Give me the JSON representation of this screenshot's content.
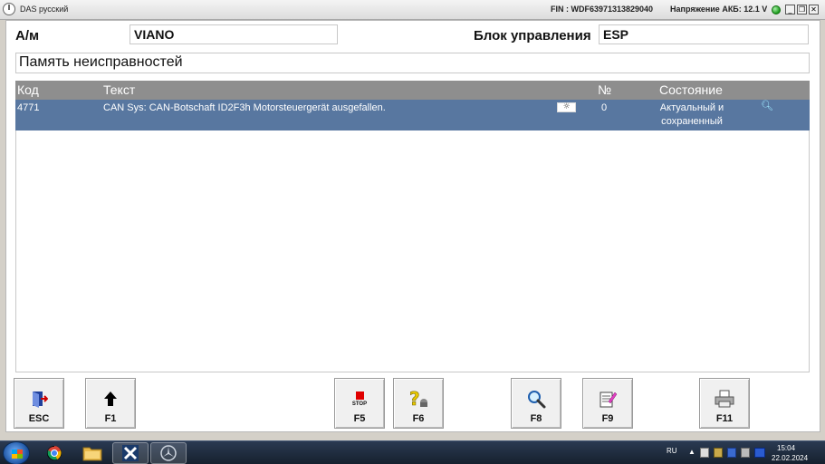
{
  "window": {
    "title": "DAS русский",
    "fin": "FIN : WDF63971313829040",
    "battery_voltage": "Напряжение АКБ: 12.1 V",
    "battery_status_color": "#1a9a1a",
    "minimize_glyph": "_",
    "restore_glyph": "❐",
    "close_glyph": "✕"
  },
  "header": {
    "vehicle_label": "А/м",
    "vehicle_value": "VIANO",
    "control_unit_label": "Блок управления",
    "control_unit_value": "ESP",
    "section_title": "Память неисправностей"
  },
  "fault_table": {
    "columns": {
      "code": "Код",
      "text": "Текст",
      "number": "№",
      "status": "Состояние"
    },
    "rows": [
      {
        "code": "4771",
        "text": "CAN Sys: CAN-Botschaft ID2F3h Motorsteuergerät ausgefallen.",
        "environment_icon": "sun-icon",
        "number": "0",
        "status_line1": "Актуальный и",
        "status_line2": "сохраненный",
        "detail_icon": "magnifier-icon",
        "selected": true
      }
    ],
    "selected_row_color": "#5877a0",
    "header_color": "#8e8e8e"
  },
  "function_keys": [
    {
      "key": "ESC",
      "icon": "exit-door-icon"
    },
    {
      "key": "F1",
      "icon": "up-arrow-icon"
    },
    {
      "key": "F5",
      "icon": "stop-icon",
      "icon_text": "STOP"
    },
    {
      "key": "F6",
      "icon": "help-question-icon"
    },
    {
      "key": "F8",
      "icon": "magnifier-icon"
    },
    {
      "key": "F9",
      "icon": "notepad-icon"
    },
    {
      "key": "F11",
      "icon": "printer-icon"
    }
  ],
  "taskbar": {
    "apps": [
      {
        "name": "chrome-icon"
      },
      {
        "name": "file-explorer-icon"
      },
      {
        "name": "das-xentry-icon"
      },
      {
        "name": "mercedes-star-icon"
      }
    ],
    "language": "RU",
    "time": "15:04",
    "date": "22.02.2024"
  }
}
